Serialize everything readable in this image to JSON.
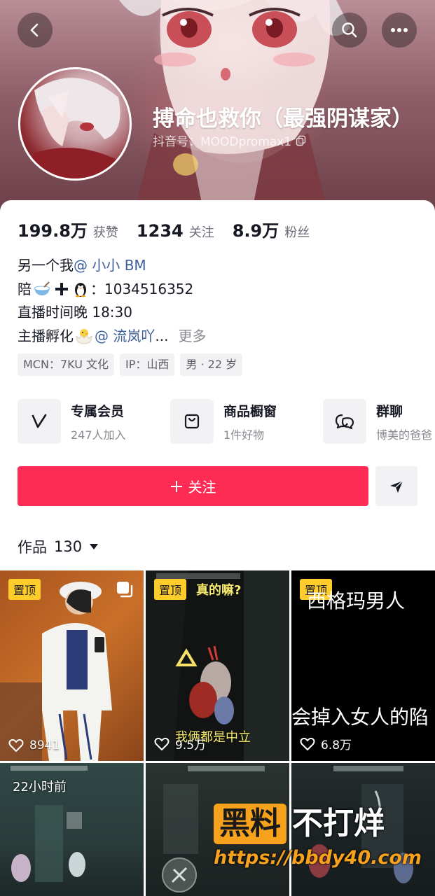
{
  "header": {
    "nickname": "搏命也救你（最强阴谋家）",
    "douyin_id": "抖音号：MOODpromax1"
  },
  "stats": [
    {
      "num": "199.8万",
      "label": "获赞"
    },
    {
      "num": "1234",
      "label": "关注"
    },
    {
      "num": "8.9万",
      "label": "粉丝"
    }
  ],
  "bio": {
    "line1_text": "另一个我",
    "line1_mention": "@ 小小 BM",
    "line2_prefix": "陪",
    "line2_suffix": "：1034516352",
    "line3": "直播时间晚 18:30",
    "line4_text": "主播孵化",
    "line4_mention": "@ 流岚吖",
    "line4_ellipsis": " ...",
    "more": "更多"
  },
  "tags": [
    "MCN：7KU 文化",
    "IP：山西",
    "男 · 22 岁"
  ],
  "features": [
    {
      "title": "专属会员",
      "sub": "247人加入",
      "icon": "v-badge-icon"
    },
    {
      "title": "商品橱窗",
      "sub": "1件好物",
      "icon": "shopping-bag-icon"
    },
    {
      "title": "群聊",
      "sub": "博美的爸爸",
      "icon": "chat-bubbles-icon"
    }
  ],
  "follow_label": "关注",
  "works": {
    "label": "作品",
    "count": "130"
  },
  "videos": [
    {
      "pinned": "置顶",
      "likes": "8941"
    },
    {
      "pinned": "置顶",
      "likes": "9.5万",
      "caption_top": "真的嘛?",
      "caption_bottom": "我俩都是中立"
    },
    {
      "pinned": "置顶",
      "likes": "6.8万",
      "caption_top": "西格玛男人",
      "caption_bottom": "会掉入女人的陷"
    },
    {
      "time": "22小时前"
    },
    {},
    {}
  ],
  "watermark": {
    "brand": "黑料",
    "brand2": "不打烊",
    "url": "https://bbdy40.com"
  },
  "colors": {
    "accent": "#fe2c55",
    "pin": "#fecd2c",
    "mention": "#3c5d9b"
  }
}
